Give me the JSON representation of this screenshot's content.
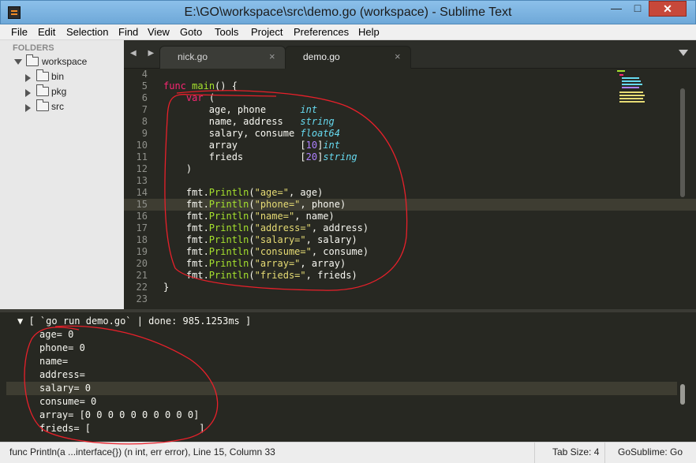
{
  "window": {
    "title": "E:\\GO\\workspace\\src\\demo.go (workspace) - Sublime Text",
    "min_glyph": "—",
    "max_glyph": "□",
    "close_glyph": "✕"
  },
  "menu": [
    "File",
    "Edit",
    "Selection",
    "Find",
    "View",
    "Goto",
    "Tools",
    "Project",
    "Preferences",
    "Help"
  ],
  "sidebar": {
    "header": "FOLDERS",
    "root": "workspace",
    "folders": [
      "bin",
      "pkg",
      "src"
    ]
  },
  "tabs": {
    "nav": "◀ ▶",
    "items": [
      {
        "label": "nick.go",
        "close": "×"
      },
      {
        "label": "demo.go",
        "close": "×"
      }
    ],
    "active": "demo.go"
  },
  "editor": {
    "current_line": 15,
    "line_numbers": [
      "4",
      "5",
      "6",
      "7",
      "8",
      "9",
      "10",
      "11",
      "12",
      "13",
      "14",
      "15",
      "16",
      "17",
      "18",
      "19",
      "20",
      "21",
      "22",
      "23"
    ],
    "code_lines": [
      "",
      "func main() {",
      "    var (",
      "        age, phone      int",
      "        name, address   string",
      "        salary, consume float64",
      "        array           [10]int",
      "        frieds          [20]string",
      "    )",
      "",
      "    fmt.Println(\"age=\", age)",
      "    fmt.Println(\"phone=\", phone)",
      "    fmt.Println(\"name=\", name)",
      "    fmt.Println(\"address=\", address)",
      "    fmt.Println(\"salary=\", salary)",
      "    fmt.Println(\"consume=\", consume)",
      "    fmt.Println(\"array=\", array)",
      "    fmt.Println(\"frieds=\", frieds)",
      "}",
      ""
    ]
  },
  "output": {
    "header": "[ `go run demo.go` | done: 985.1253ms ]",
    "header_arrow": "▼",
    "highlighted_line": 4,
    "lines": [
      "age= 0",
      "phone= 0",
      "name=",
      "address=",
      "salary= 0",
      "consume= 0",
      "array= [0 0 0 0 0 0 0 0 0 0]",
      "frieds= [                   ]"
    ]
  },
  "status": {
    "left": "func Println(a ...interface{}) (n int, err error), Line 15, Column 33",
    "tab_size": "Tab Size: 4",
    "syntax": "GoSublime: Go"
  },
  "colors": {
    "bg": "#272822",
    "keyword": "#f92672",
    "function": "#a6e22e",
    "type": "#66d9ef",
    "string": "#e6db74",
    "number": "#ae81ff",
    "annotation": "#e8202a"
  }
}
